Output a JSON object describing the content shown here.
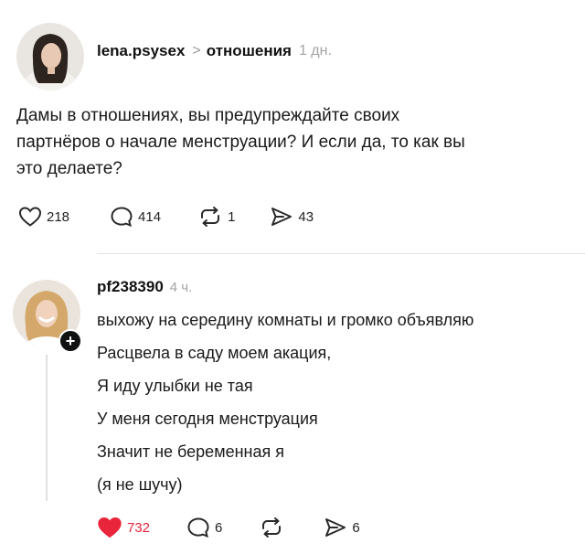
{
  "post": {
    "username": "lena.psysex",
    "separator": ">",
    "topic": "отношения",
    "time": "1 дн.",
    "text_lines": [
      "Дамы в отношениях, вы предупреждайте своих",
      "партнёров о начале менструации? И если да, то как вы",
      "это делаете?"
    ],
    "likes": "218",
    "comments": "414",
    "reposts": "1",
    "shares": "43"
  },
  "reply": {
    "username": "pf238390",
    "time": "4 ч.",
    "plus_symbol": "+",
    "lines": [
      "выхожу на середину комнаты и громко объявляю",
      "Расцвела в саду моем акация,",
      "Я иду улыбки не тая",
      "У меня сегодня менструация",
      "Значит не беременная я",
      "(я не шучу)"
    ],
    "likes": "732",
    "comments": "6",
    "reposts": "",
    "shares": "6"
  },
  "colors": {
    "liked": "#e8253a",
    "icon": "#2a2a2a",
    "muted": "#a3a3a3",
    "divider": "#e5e5e5"
  },
  "icons": [
    "heart-icon",
    "comment-icon",
    "repost-icon",
    "share-icon",
    "chevron-right-icon",
    "plus-icon"
  ]
}
